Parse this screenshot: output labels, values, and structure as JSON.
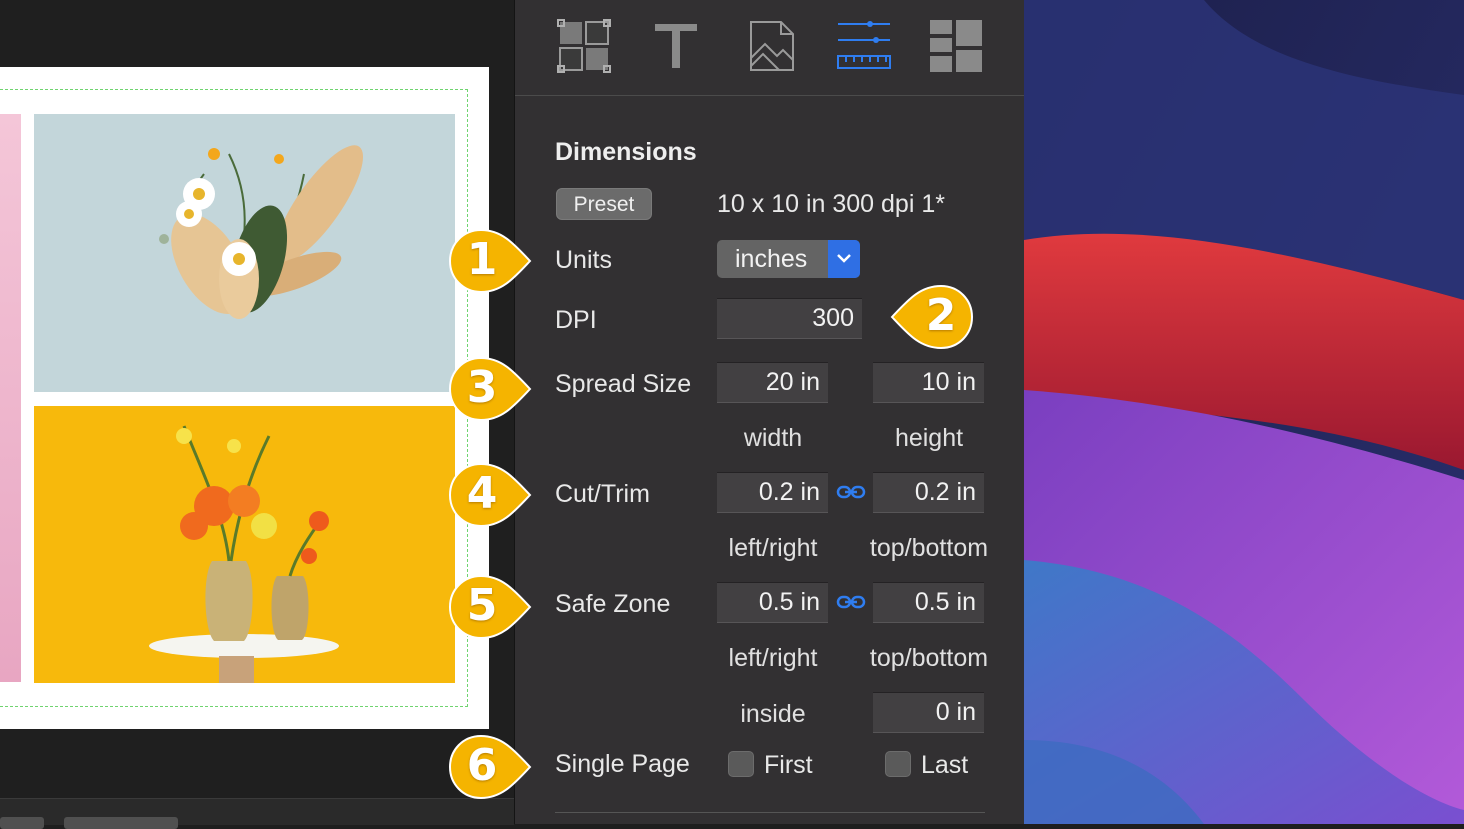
{
  "toolbar": {
    "tools": [
      {
        "icon": "layout-grid-icon",
        "active": false
      },
      {
        "icon": "text-tool-icon",
        "active": false
      },
      {
        "icon": "image-page-icon",
        "active": false
      },
      {
        "icon": "dimensions-ruler-icon",
        "active": true
      },
      {
        "icon": "templates-icon",
        "active": false
      }
    ]
  },
  "dimensions": {
    "title": "Dimensions",
    "preset_label": "Preset",
    "preset_value": "10 x 10 in 300 dpi 1*",
    "units_label": "Units",
    "units_value": "inches",
    "dpi_label": "DPI",
    "dpi_value": "300",
    "spread_label": "Spread Size",
    "spread_width": "20 in",
    "spread_height": "10 in",
    "width_label": "width",
    "height_label": "height",
    "cut_label": "Cut/Trim",
    "cut_lr": "0.2 in",
    "cut_tb": "0.2 in",
    "cut_lr_label": "left/right",
    "cut_tb_label": "top/bottom",
    "safe_label": "Safe Zone",
    "safe_lr": "0.5 in",
    "safe_tb": "0.5 in",
    "safe_lr_label": "left/right",
    "safe_tb_label": "top/bottom",
    "inside_label": "inside",
    "inside_value": "0 in",
    "single_label": "Single Page",
    "first_label": "First",
    "last_label": "Last"
  },
  "callouts": [
    "1",
    "2",
    "3",
    "4",
    "5",
    "6"
  ],
  "colors": {
    "accent": "#2f6fe4",
    "callout": "#f5b400",
    "safe_zone_guide": "#6fd46f",
    "panel_bg": "#323032"
  }
}
